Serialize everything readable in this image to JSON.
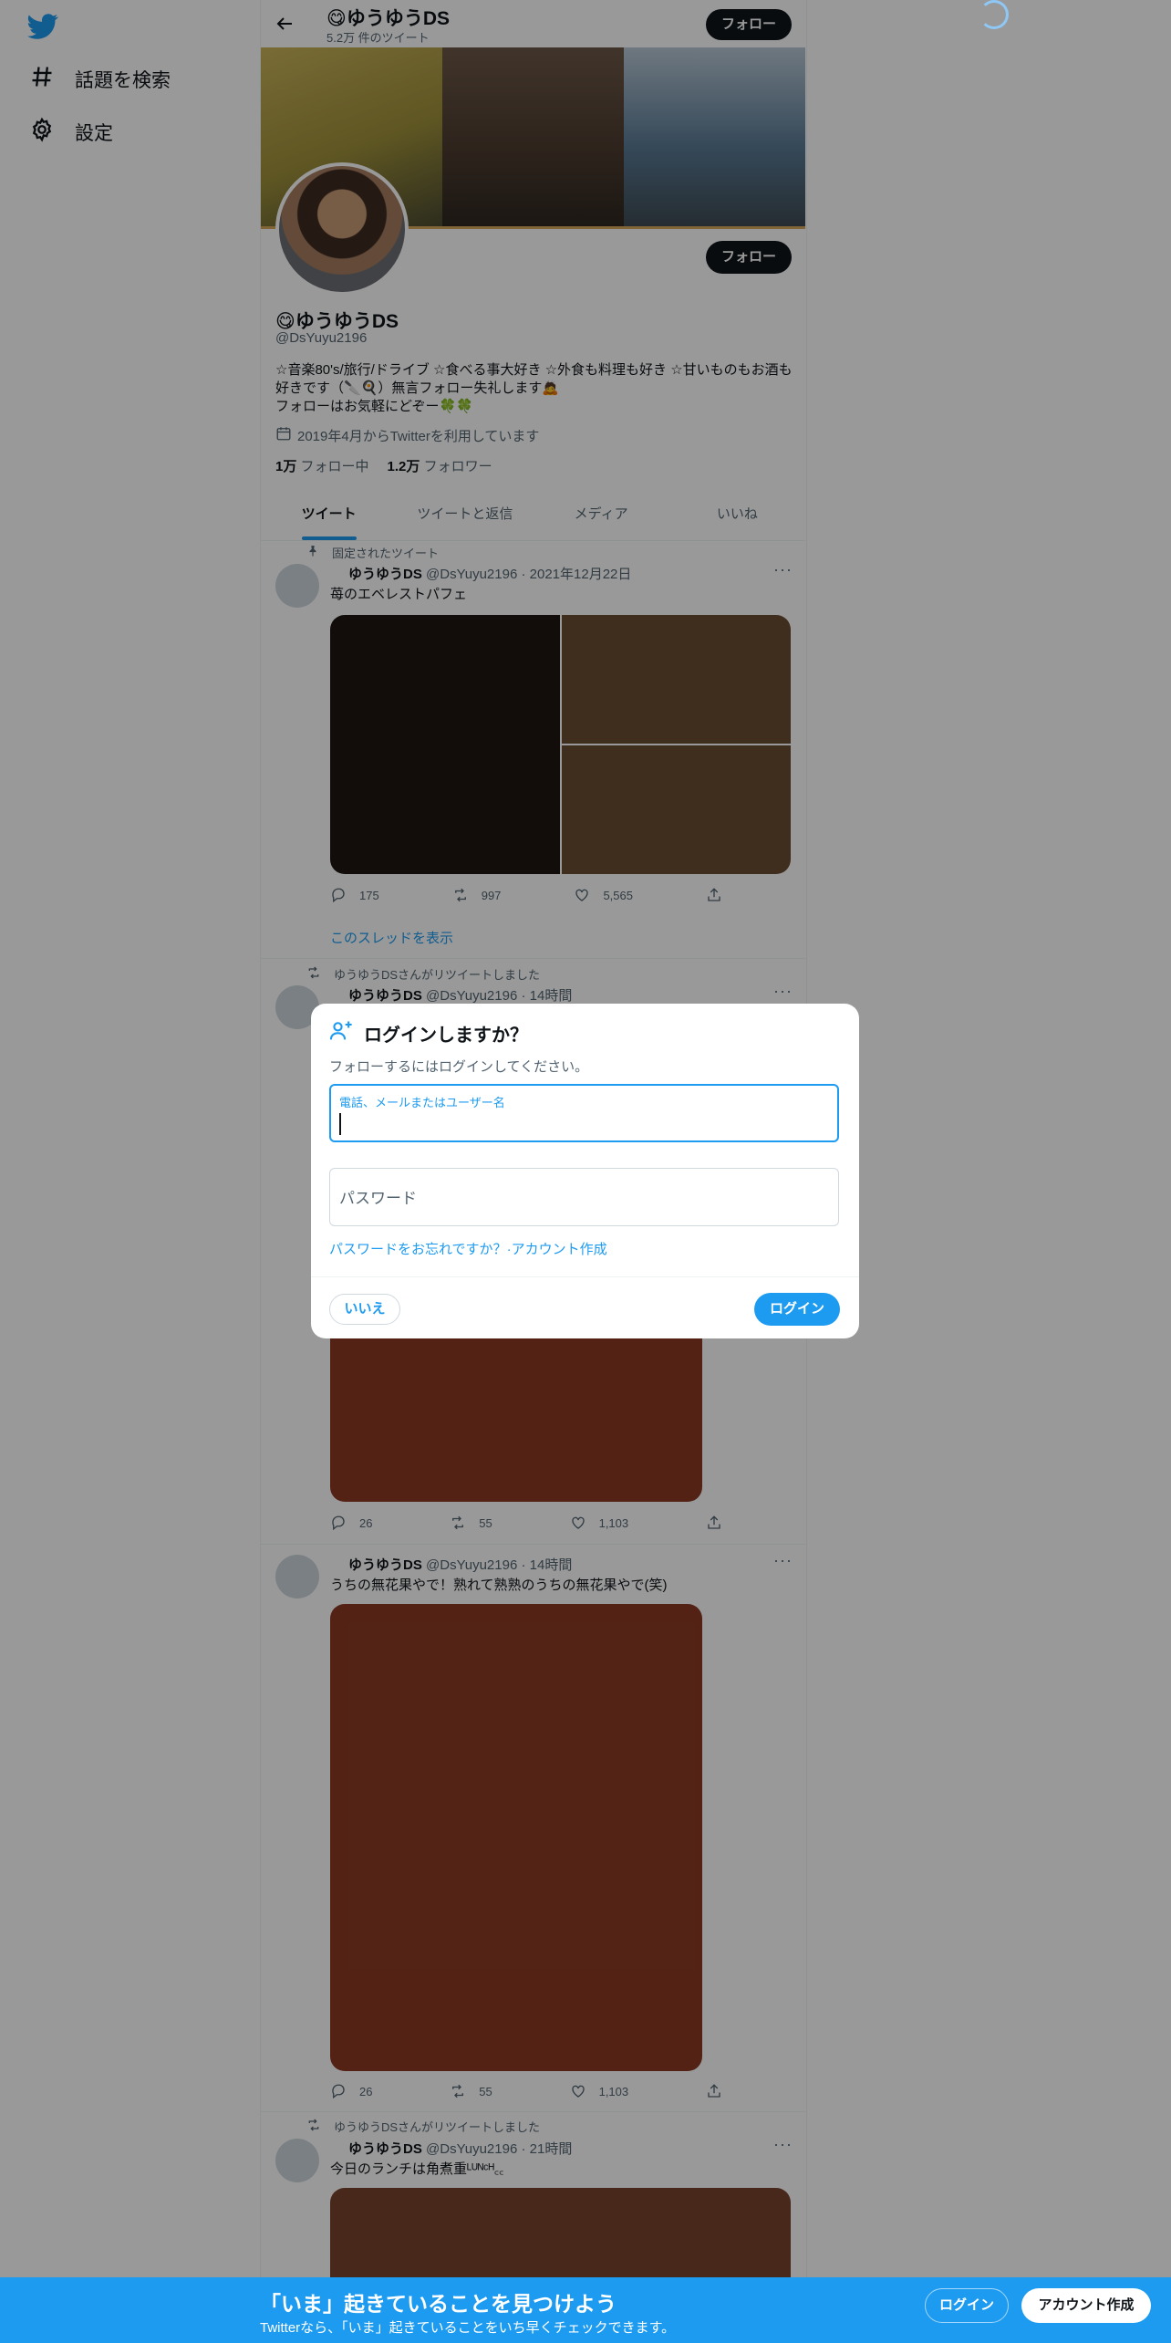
{
  "nav": {
    "logo_icon": "twitter-bird-icon",
    "items": [
      {
        "icon": "hashtag-icon",
        "label": "話題を検索"
      },
      {
        "icon": "gear-icon",
        "label": "設定"
      }
    ]
  },
  "header": {
    "name": "😋ゆうゆうDS",
    "tweet_count": "5.2万 件のツイート",
    "follow_label": "フォロー"
  },
  "profile": {
    "name": "😋ゆうゆうDS",
    "handle": "@DsYuyu2196",
    "bio": "☆音楽80's/旅行/ドライブ ☆食べる事大好き ☆外食も料理も好き ☆甘いものもお酒も好きです（🔪🍳）無言フォロー失礼します🙇\nフォローはお気軽にどぞー🍀🍀",
    "joined": "2019年4月からTwitterを利用しています",
    "following_count": "1万",
    "following_label": "フォロー中",
    "followers_count": "1.2万",
    "followers_label": "フォロワー",
    "follow_label": "フォロー",
    "banner_colors": [
      "#b9a64a",
      "#5a4636",
      "#4f6b86"
    ],
    "accent_color": "#1d9bf0"
  },
  "tabs": [
    {
      "label": "ツイート",
      "active": true
    },
    {
      "label": "ツイートと返信",
      "active": false
    },
    {
      "label": "メディア",
      "active": false
    },
    {
      "label": "いいね",
      "active": false
    }
  ],
  "tweets": [
    {
      "context": "固定されたツイート",
      "name": "ゆうゆうDS",
      "handle_time": "@DsYuyu2196 · 2021年12月22日",
      "text": "苺のエベレストパフェ",
      "replies": "175",
      "retweets": "997",
      "likes": "5,565",
      "thread_link": "このスレッドを表示",
      "media_colors": [
        "#1e1512",
        "#6a4c33",
        "#6a4c33"
      ]
    },
    {
      "context": "ゆうゆうDSさんがリツイートしました",
      "name": "ゆうゆうDS",
      "handle_time": "@DsYuyu2196 · 14時間",
      "replies": "26",
      "retweets": "55",
      "likes": "1,103",
      "media_color": "#8a3a24"
    },
    {
      "name": "ゆうゆうDS",
      "handle_time": "@DsYuyu2196 · 14時間",
      "text": "うちの無花果やで！熟れて熟熟のうちの無花果やで(笑)",
      "replies": "26",
      "retweets": "55",
      "likes": "1,103",
      "media_color": "#8a3a24"
    },
    {
      "context": "ゆうゆうDSさんがリツイートしました",
      "name": "ゆうゆうDS",
      "handle_time": "@DsYuyu2196 · 21時間",
      "text": "今日のランチは角煮重ᴸᵁᴺᶜᴴ꜀꜀",
      "media_color": "#7a4430"
    }
  ],
  "modal": {
    "title": "ログインしますか？",
    "subtitle": "フォローするにはログインしてください。",
    "username_label": "電話、メールまたはユーザー名",
    "username_value": "",
    "password_placeholder": "パスワード",
    "forgot_link": "パスワードをお忘れですか？",
    "separator": "·",
    "signup_link": "アカウント作成",
    "no_label": "いいえ",
    "login_label": "ログイン"
  },
  "bottom_bar": {
    "title": "「いま」起きていることを見つけよう",
    "subtitle": "Twitterなら、「いま」起きていることをいち早くチェックできます。",
    "login_label": "ログイン",
    "signup_label": "アカウント作成"
  }
}
